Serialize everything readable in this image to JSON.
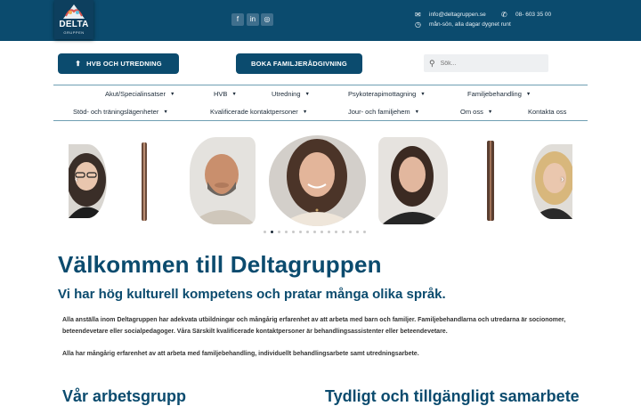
{
  "logo": {
    "word": "DELTA",
    "sub": "GRUPPEN"
  },
  "social": [
    {
      "name": "facebook-icon",
      "glyph": "f"
    },
    {
      "name": "linkedin-icon",
      "glyph": "in"
    },
    {
      "name": "instagram-icon",
      "glyph": "◎"
    }
  ],
  "contact": {
    "email": "info@deltagruppen.se",
    "phone": "08- 603 35 00",
    "hours": "mån-sön, alla dagar dygnet runt"
  },
  "buttons": {
    "hvb": "HVB OCH UTREDNING",
    "boka": "BOKA FAMILJERÅDGIVNING"
  },
  "search": {
    "placeholder": "Sök..."
  },
  "nav": {
    "row1": [
      {
        "label": "Akut/Specialinsatser",
        "caret": true
      },
      {
        "label": "HVB",
        "caret": true
      },
      {
        "label": "Utredning",
        "caret": true
      },
      {
        "label": "Psykoterapimottagning",
        "caret": true
      },
      {
        "label": "Familjebehandling",
        "caret": true
      }
    ],
    "row2": [
      {
        "label": "Stöd- och träningslägenheter",
        "caret": true
      },
      {
        "label": "Kvalificerade kontaktpersoner",
        "caret": true
      },
      {
        "label": "Jour- och familjehem",
        "caret": true
      },
      {
        "label": "Om oss",
        "caret": true
      },
      {
        "label": "Kontakta oss",
        "caret": false
      }
    ]
  },
  "carousel": {
    "prev": "‹",
    "next": "›",
    "dots_total": 15,
    "active_dot": 2
  },
  "content": {
    "title": "Välkommen till Deltagruppen",
    "subtitle": "Vi har hög kulturell kompetens och pratar många olika språk.",
    "p1": "Alla anställa inom Deltagruppen har adekvata utbildningar och mångårig erfarenhet av att arbeta med barn och familjer. Familjebehandlarna och utredarna är socionomer, beteendevetare eller socialpedagoger. Våra Särskilt kvalificerade kontaktpersoner är behandlingsassistenter eller beteendevetare.",
    "p2": "Alla har mångårig erfarenhet av att arbeta med familjebehandling, individuellt behandlingsarbete samt utredningsarbete.",
    "col1_heading": "Vår arbetsgrupp",
    "col2_heading": "Tydligt och tillgängligt samarbete"
  },
  "colors": {
    "brand": "#0b4b6e",
    "topbar": "#0b4b6e"
  }
}
